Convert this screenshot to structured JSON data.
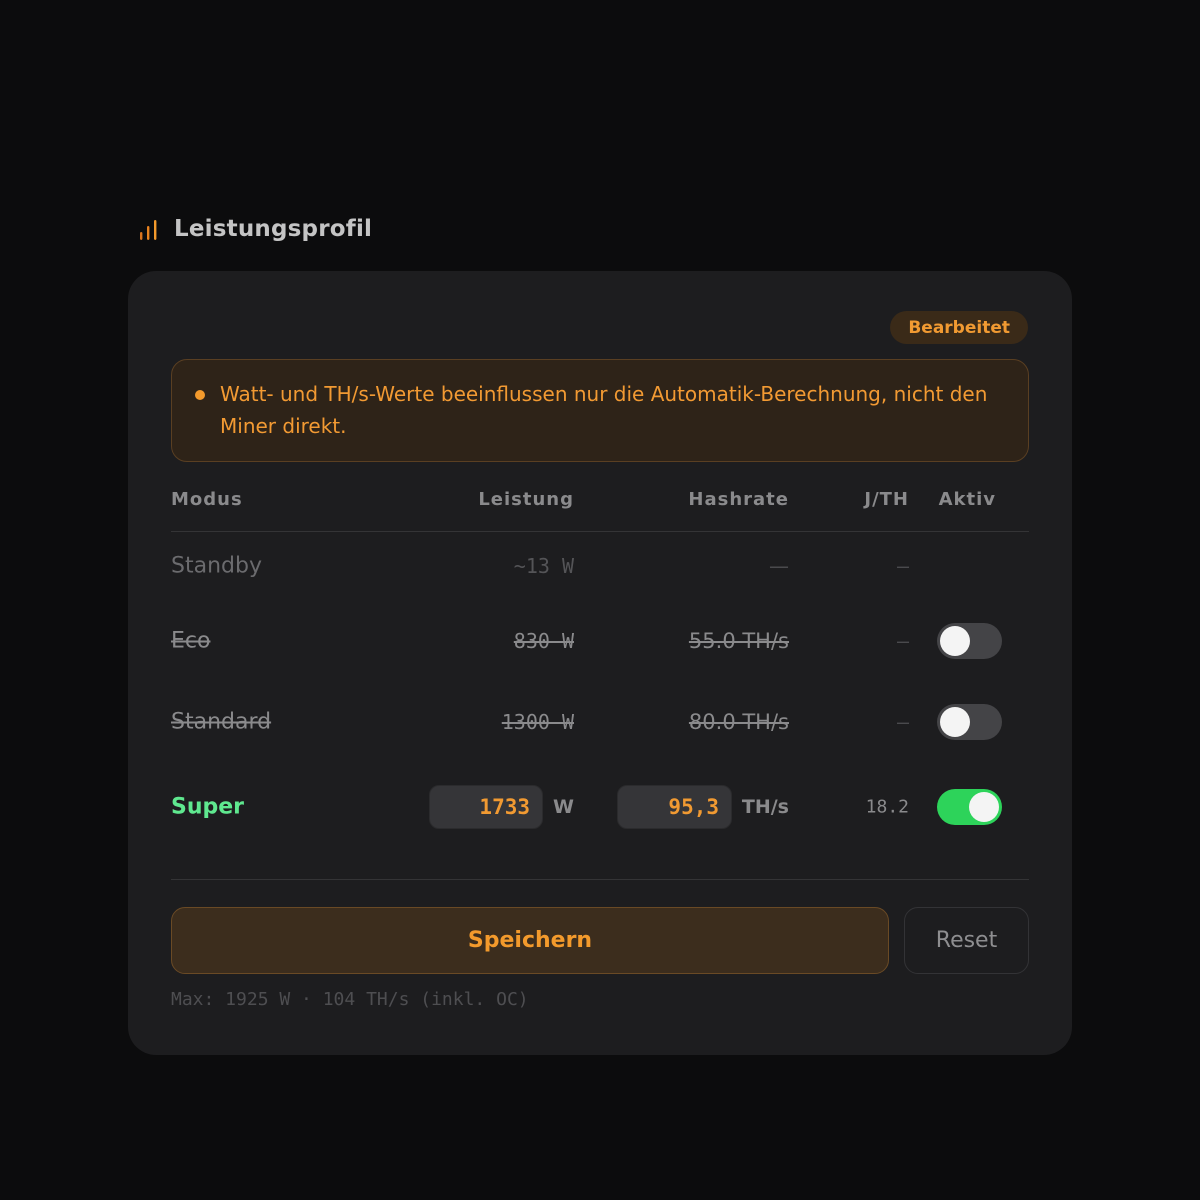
{
  "section": {
    "title": "Leistungsprofil",
    "icon": "signal-bars-icon",
    "accent_color": "#f19a32"
  },
  "card": {
    "badge": "Bearbeitet",
    "notice": "Watt- und TH/s-Werte beeinflussen nur die Automatik-Berechnung, nicht den Miner direkt."
  },
  "table": {
    "headers": {
      "mode": "Modus",
      "power": "Leistung",
      "hashrate": "Hashrate",
      "jth": "J/TH",
      "active": "Aktiv"
    },
    "rows": [
      {
        "mode": "Standby",
        "power": "~13 W",
        "hashrate": "—",
        "jth": "—"
      },
      {
        "mode": "Eco",
        "power": "830 W",
        "hashrate": "55.0 TH/s",
        "jth": "—",
        "active": false
      },
      {
        "mode": "Standard",
        "power": "1300 W",
        "hashrate": "80.0 TH/s",
        "jth": "—",
        "active": false
      },
      {
        "mode": "Super",
        "power_value": "1733",
        "power_unit": "W",
        "hashrate_value": "95,3",
        "hashrate_unit": "TH/s",
        "jth": "18.2",
        "active": true
      }
    ]
  },
  "actions": {
    "save_label": "Speichern",
    "reset_label": "Reset"
  },
  "footnote": "Max: 1925 W · 104 TH/s (inkl. OC)",
  "colors": {
    "toggle_on": "#2dd35a",
    "super_label": "#5fe88f"
  }
}
